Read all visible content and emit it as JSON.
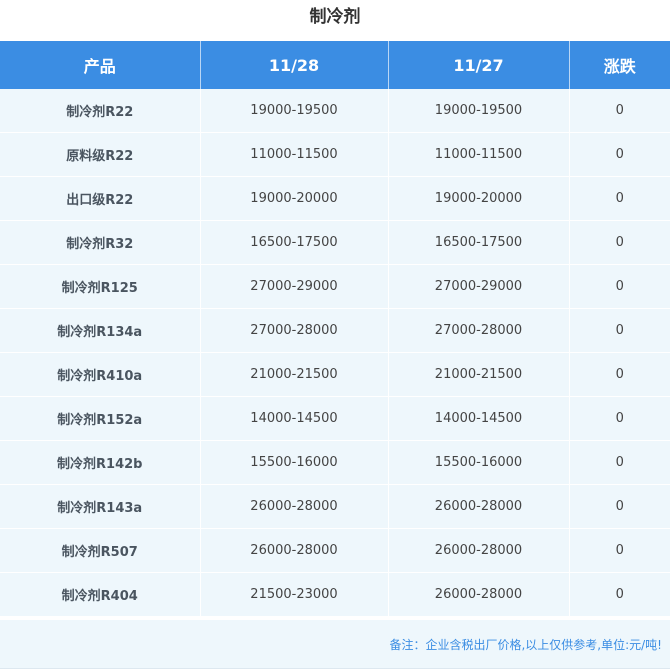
{
  "page": {
    "title": "制冷剂"
  },
  "table": {
    "headers": [
      "产品",
      "11/28",
      "11/27",
      "涨跌"
    ],
    "rows": [
      {
        "product": "制冷剂R22",
        "price_1128": "19000-19500",
        "price_1127": "19000-19500",
        "change": "0"
      },
      {
        "product": "原料级R22",
        "price_1128": "11000-11500",
        "price_1127": "11000-11500",
        "change": "0"
      },
      {
        "product": "出口级R22",
        "price_1128": "19000-20000",
        "price_1127": "19000-20000",
        "change": "0"
      },
      {
        "product": "制冷剂R32",
        "price_1128": "16500-17500",
        "price_1127": "16500-17500",
        "change": "0"
      },
      {
        "product": "制冷剂R125",
        "price_1128": "27000-29000",
        "price_1127": "27000-29000",
        "change": "0"
      },
      {
        "product": "制冷剂R134a",
        "price_1128": "27000-28000",
        "price_1127": "27000-28000",
        "change": "0"
      },
      {
        "product": "制冷剂R410a",
        "price_1128": "21000-21500",
        "price_1127": "21000-21500",
        "change": "0"
      },
      {
        "product": "制冷剂R152a",
        "price_1128": "14000-14500",
        "price_1127": "14000-14500",
        "change": "0"
      },
      {
        "product": "制冷剂R142b",
        "price_1128": "15500-16000",
        "price_1127": "15500-16000",
        "change": "0"
      },
      {
        "product": "制冷剂R143a",
        "price_1128": "26000-28000",
        "price_1127": "26000-28000",
        "change": "0"
      },
      {
        "product": "制冷剂R507",
        "price_1128": "26000-28000",
        "price_1127": "26000-28000",
        "change": "0"
      },
      {
        "product": "制冷剂R404",
        "price_1128": "21500-23000",
        "price_1127": "26000-28000",
        "change": "0"
      }
    ]
  },
  "footer": {
    "note": "备注：企业含税出厂价格,以上仅供参考,单位:元/吨!"
  },
  "colors": {
    "header_bg": "#3b8de3",
    "row_bg": "#eef7fc",
    "note_text": "#3b8de3"
  }
}
